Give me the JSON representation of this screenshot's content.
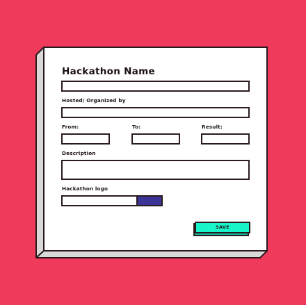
{
  "colors": {
    "background": "#ef3a5c",
    "panel": "#ffffff",
    "panel_side": "#d9d9d9",
    "outline": "#2a1a1e",
    "upload_button": "#3b3597",
    "save_button": "#19f5c8",
    "save_button_shadow": "#0fb89a"
  },
  "form": {
    "title": "Hackathon Name",
    "name_value": "",
    "hosted_label": "Hosted/ Organized by",
    "hosted_value": "",
    "from_label": "From:",
    "from_value": "",
    "to_label": "To:",
    "to_value": "",
    "result_label": "Result:",
    "result_value": "",
    "description_label": "Description",
    "description_value": "",
    "logo_label": "Hackathon logo",
    "save_label": "SAVE"
  },
  "icons": {
    "upload_button": "upload-button-icon"
  }
}
